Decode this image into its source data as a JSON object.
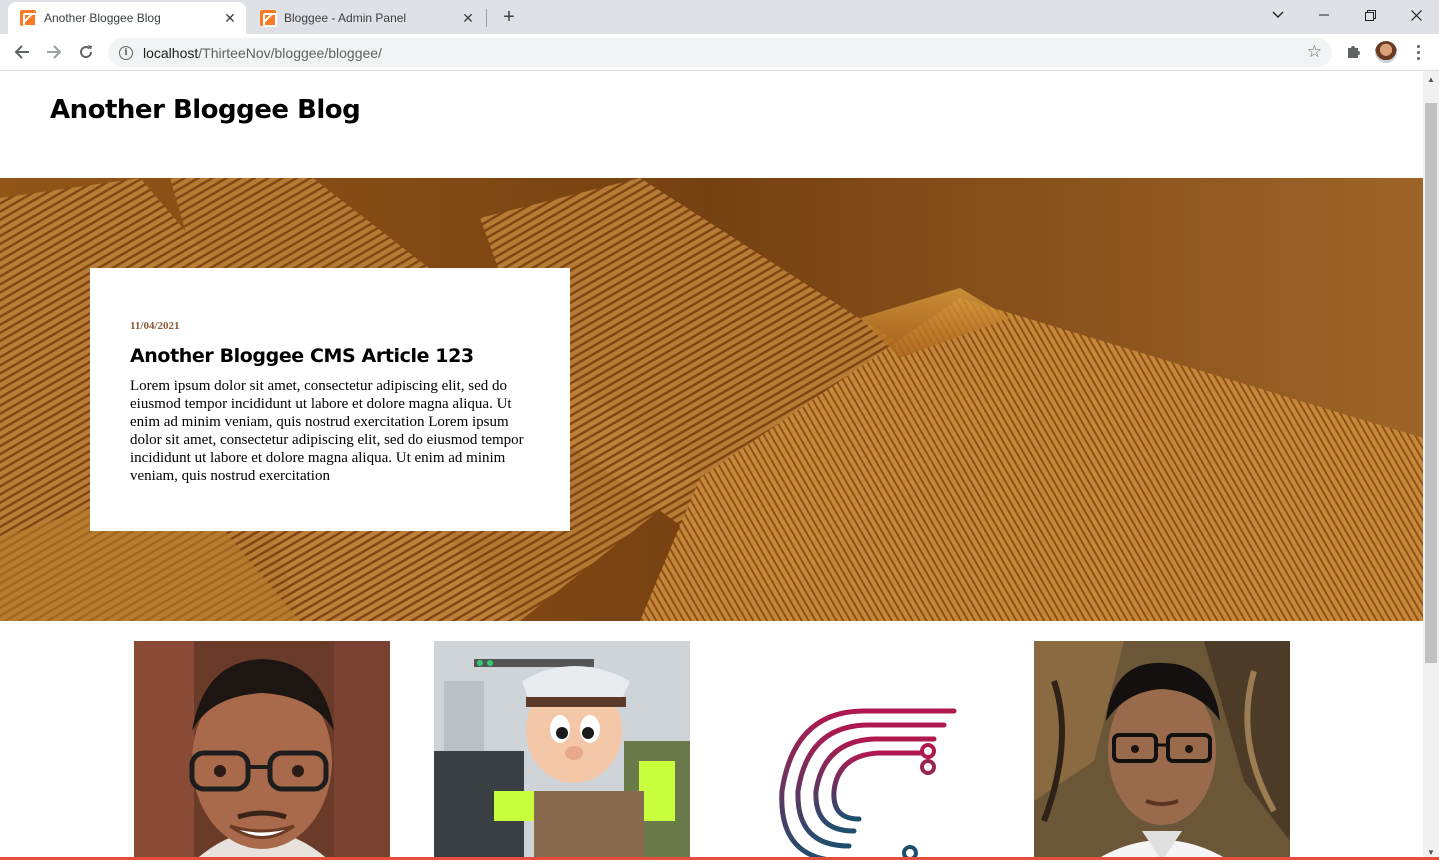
{
  "browser": {
    "tabs": [
      {
        "title": "Another Bloggee Blog",
        "active": true
      },
      {
        "title": "Bloggee - Admin Panel",
        "active": false
      }
    ],
    "address": {
      "host": "localhost",
      "path": "/ThirteeNov/bloggee/bloggee/"
    }
  },
  "site": {
    "title": "Another Bloggee Blog"
  },
  "featured": {
    "date": "11/04/2021",
    "title": "Another Bloggee CMS Article 123",
    "excerpt": "Lorem ipsum dolor sit amet, consectetur adipiscing elit, sed do eiusmod tempor incididunt ut labore et dolore magna aliqua. Ut enim ad minim veniam, quis nostrud exercitation Lorem ipsum dolor sit amet, consectetur adipiscing elit, sed do eiusmod tempor incididunt ut labore et dolore magna aliqua. Ut enim ad minim veniam, quis nostrud exercitation"
  },
  "thumbnails": [
    {
      "subject": "smiling-man-with-glasses"
    },
    {
      "subject": "police-mascot-costume"
    },
    {
      "subject": "c-circuit-logo"
    },
    {
      "subject": "man-with-glasses-portrait"
    }
  ],
  "colors": {
    "date": "#8a5a3c",
    "hero": "#a9641e",
    "tabbar": "#dee1e6",
    "bottom_bar": "#e74c3c"
  }
}
